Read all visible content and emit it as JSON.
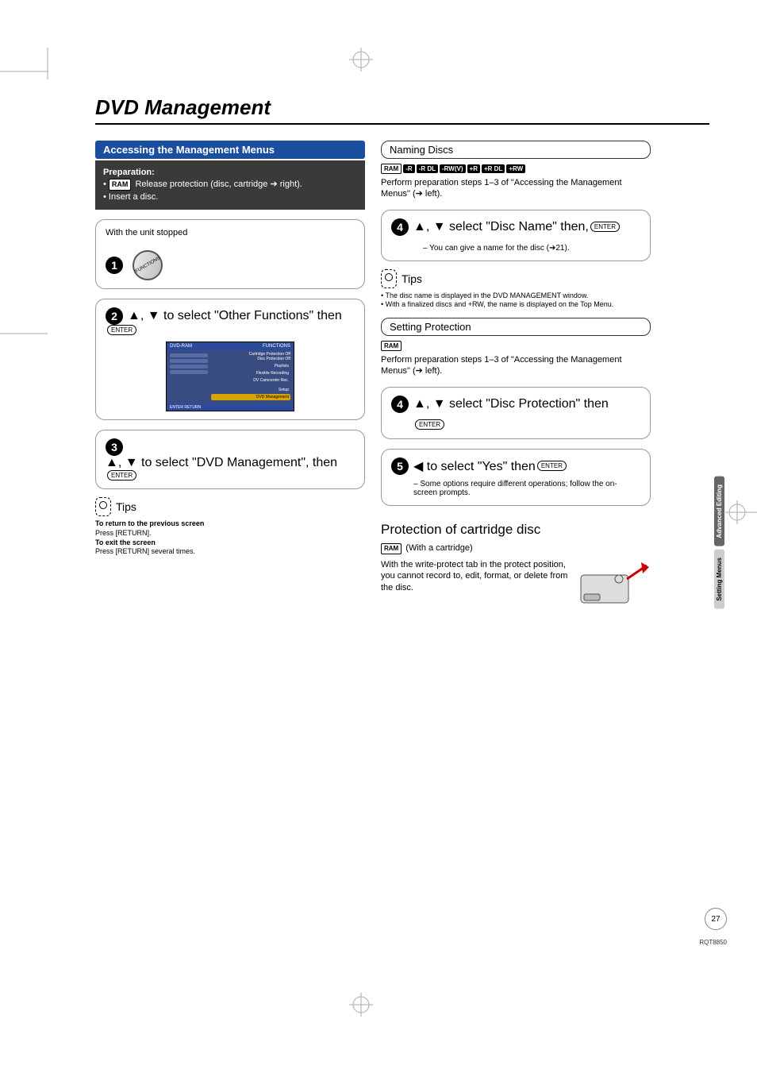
{
  "page": {
    "title": "DVD Management",
    "number": "27",
    "doc_code": "RQT8850"
  },
  "side_tabs": {
    "top": "Advanced Editing",
    "bottom": "Setting Menus"
  },
  "left": {
    "section_title": "Accessing the Management Menus",
    "prep": {
      "heading": "Preparation:",
      "line1_badge": "RAM",
      "line1": "Release protection (disc, cartridge ➔ right).",
      "line2": "Insert a disc."
    },
    "step1": {
      "caption": "With the unit stopped",
      "btn_label": "FUNCTIONS"
    },
    "step2": {
      "prefix": "▲, ▼ to select \"Other Functions\" then",
      "enter": "ENTER"
    },
    "mini": {
      "brand": "DVD-RAM",
      "menu": "FUNCTIONS",
      "info1": "Cartridge Protection  Off",
      "info2": "Disc Protection  Off",
      "side0": "DVD-RAM",
      "opt1": "Playlists",
      "opt2": "Flexible Recording",
      "opt3": "DV Camcorder Rec.",
      "opt4": "Setup",
      "opt5": "DVD Management",
      "bottom": "ENTER  RETURN"
    },
    "step3": {
      "text": "▲, ▼ to select \"DVD Management\", then",
      "enter": "ENTER"
    },
    "tips": {
      "label": "Tips",
      "h1": "To return to the previous screen",
      "t1": "Press [RETURN].",
      "h2": "To exit the screen",
      "t2": "Press [RETURN] several times."
    }
  },
  "right": {
    "naming": {
      "header": "Naming Discs",
      "badges": [
        "RAM",
        "-R",
        "-R DL",
        "-RW(V)",
        "+R",
        "+R DL",
        "+RW"
      ],
      "intro": "Perform preparation steps 1–3 of \"Accessing the Management Menus\" (➔ left).",
      "step4a": "▲, ▼ select \"Disc Name\" then,",
      "enter": "ENTER",
      "note": "– You can give a name for the disc (➔21).",
      "tips_label": "Tips",
      "tip1": "The disc name is displayed in the DVD MANAGEMENT window.",
      "tip2": "With a finalized discs and +RW, the name is displayed on the Top Menu."
    },
    "protect": {
      "header": "Setting Protection",
      "badge": "RAM",
      "intro": "Perform preparation steps 1–3 of \"Accessing the Management Menus\" (➔ left).",
      "step4": "▲, ▼ select \"Disc Protection\" then",
      "enter4": "ENTER",
      "step5": "◀ to select \"Yes\" then",
      "enter5": "ENTER",
      "note5": "– Some options require different operations; follow the on-screen prompts."
    },
    "cartridge": {
      "heading": "Protection of cartridge disc",
      "badge": "RAM",
      "qual": "(With a cartridge)",
      "text": "With the write-protect tab in the protect position, you cannot record to, edit, format, or delete from the disc."
    }
  }
}
